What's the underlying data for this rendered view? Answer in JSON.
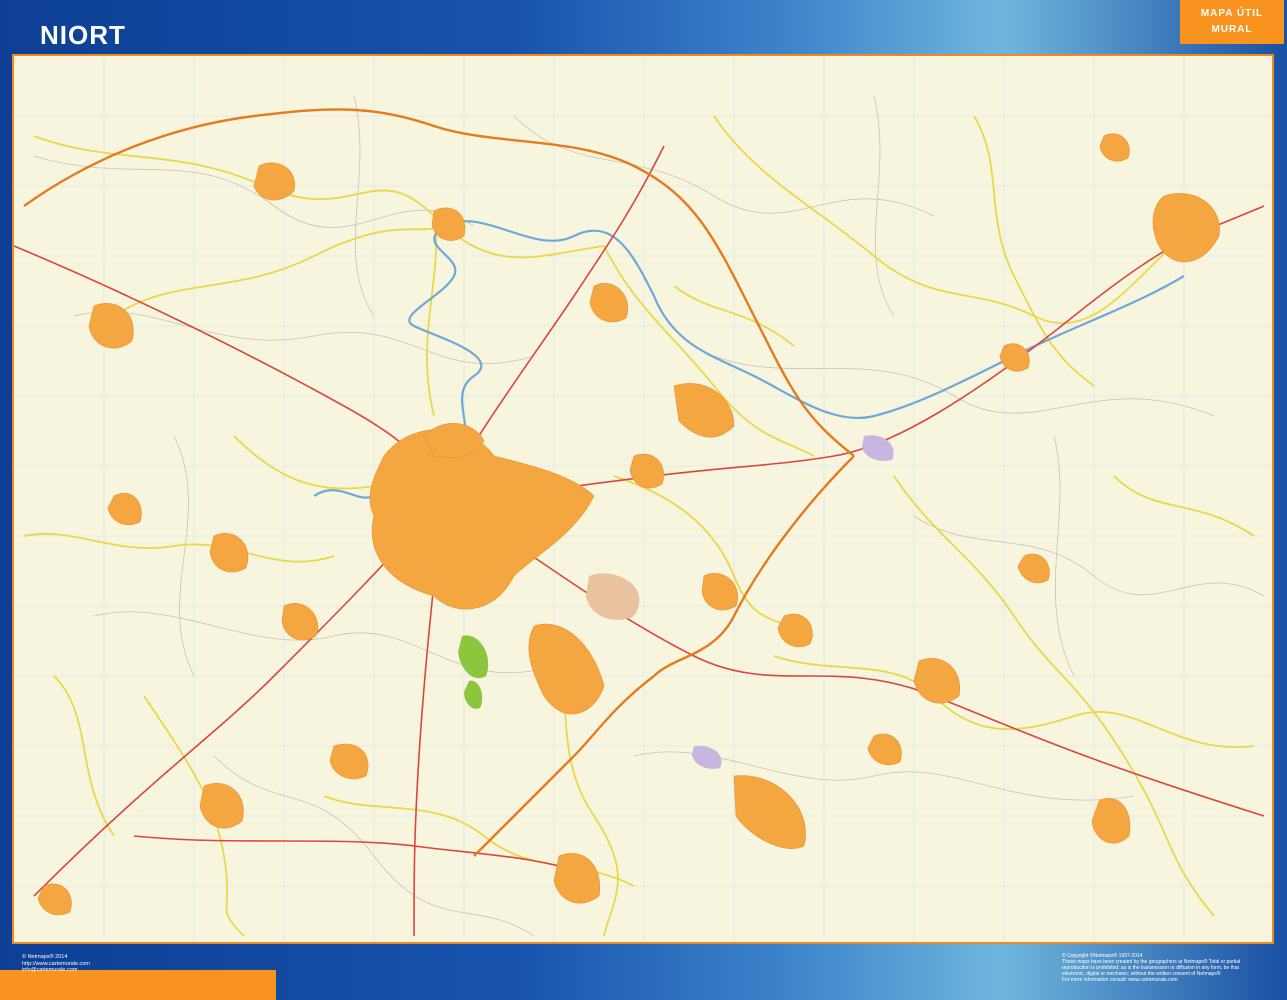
{
  "header": {
    "title": "NIORT",
    "badge_line1": "MAPA ÚTIL",
    "badge_line2": "MURAL"
  },
  "colors": {
    "frame_blue": "#1753ad",
    "accent_orange": "#f7931e",
    "map_background": "#f8f5df",
    "urban_area": "#f4a640",
    "main_road": "#d9473e",
    "secondary_road": "#e8d84a",
    "motorway": "#e47b1f",
    "river": "#6fa8d8",
    "park": "#8cc63f"
  },
  "footer": {
    "left_lines": [
      "© Netmaps® 2014",
      "http://www.cartemurale.com",
      "info@cartemurale.com"
    ],
    "right_lines": [
      "© Copyright ©Netmaps® 1997-2014",
      "These maps have been created by the geographers at Netmaps® Total or partial",
      "reproduction is prohibited; as is the transmission or diffusion in any form, be that",
      "electronic, digital or mechanic; without the written consent of Netmaps®",
      "For more information consult: www.cartemurale.com"
    ]
  }
}
